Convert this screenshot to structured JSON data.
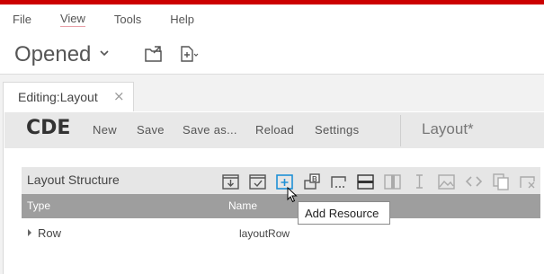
{
  "menubar": {
    "items": [
      "File",
      "View",
      "Tools",
      "Help"
    ]
  },
  "openbar": {
    "dropdown_label": "Opened",
    "icons": [
      "open-folder-icon",
      "new-file-icon"
    ]
  },
  "tabs": [
    {
      "label": "Editing:Layout",
      "close": "×"
    }
  ],
  "cde": {
    "logo": "CDE",
    "actions": [
      "New",
      "Save",
      "Save as...",
      "Reload",
      "Settings"
    ],
    "document_title": "Layout*"
  },
  "panel": {
    "title": "Layout Structure",
    "toolbar_icons": [
      "save-template-icon",
      "apply-template-icon",
      "add-resource-icon",
      "add-bootstrap-panel-icon",
      "add-freeform-icon",
      "add-row-icon",
      "add-columns-icon",
      "add-space-icon",
      "add-image-icon",
      "add-html-icon",
      "duplicate-icon",
      "delete-icon"
    ],
    "columns": [
      "Type",
      "Name"
    ],
    "rows": [
      {
        "type": "Row",
        "name": "layoutRow"
      }
    ]
  },
  "tooltip": "Add Resource",
  "colors": {
    "accent_red": "#cc0000",
    "header_gray": "#9e9e9e",
    "icon_blue": "#1e90d6",
    "icon_gray": "#555555"
  }
}
